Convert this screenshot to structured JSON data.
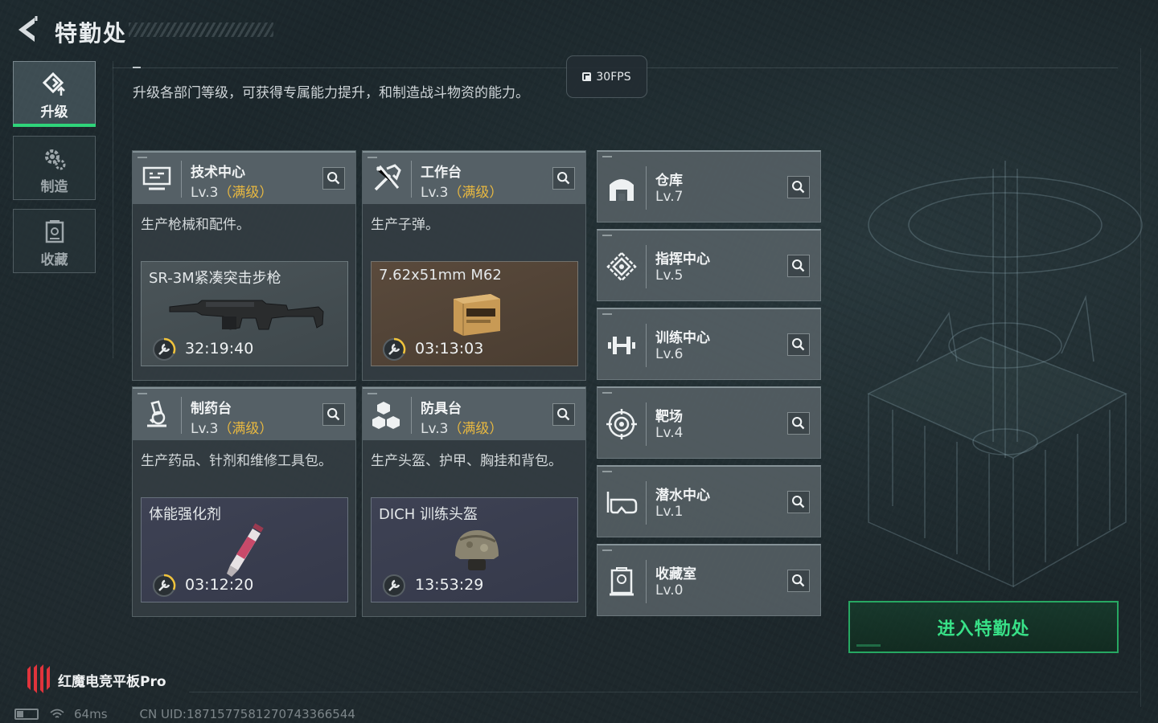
{
  "header": {
    "title": "特勤处",
    "description": "升级各部门等级，可获得专属能力提升，和制造战斗物资的能力。",
    "fps": "30FPS"
  },
  "nav": [
    {
      "label": "升级",
      "icon": "upgrade-icon",
      "active": true
    },
    {
      "label": "制造",
      "icon": "gears-icon",
      "active": false
    },
    {
      "label": "收藏",
      "icon": "collection-icon",
      "active": false
    }
  ],
  "cards": [
    {
      "name": "技术中心",
      "level": "Lv.3",
      "max": "（满级）",
      "desc": "生产枪械和配件。",
      "product": "SR-3M紧凑突击步枪",
      "timer": "32:19:40",
      "icon": "computer-icon"
    },
    {
      "name": "工作台",
      "level": "Lv.3",
      "max": "（满级）",
      "desc": "生产子弹。",
      "product": "7.62x51mm M62",
      "timer": "03:13:03",
      "icon": "tools-icon"
    },
    {
      "name": "制药台",
      "level": "Lv.3",
      "max": "（满级）",
      "desc": "生产药品、针剂和维修工具包。",
      "product": "体能强化剂",
      "timer": "03:12:20",
      "icon": "microscope-icon"
    },
    {
      "name": "防具台",
      "level": "Lv.3",
      "max": "（满级）",
      "desc": "生产头盔、护甲、胸挂和背包。",
      "product": "DICH 训练头盔",
      "timer": "13:53:29",
      "icon": "armor-blocks-icon"
    }
  ],
  "small_cards": [
    {
      "name": "仓库",
      "level": "Lv.7",
      "icon": "warehouse-icon"
    },
    {
      "name": "指挥中心",
      "level": "Lv.5",
      "icon": "command-center-icon"
    },
    {
      "name": "训练中心",
      "level": "Lv.6",
      "icon": "dumbbell-icon"
    },
    {
      "name": "靶场",
      "level": "Lv.4",
      "icon": "target-icon"
    },
    {
      "name": "潜水中心",
      "level": "Lv.1",
      "icon": "diving-mask-icon"
    },
    {
      "name": "收藏室",
      "level": "Lv.0",
      "icon": "collection-room-icon"
    }
  ],
  "enter_button": "进入特勤处",
  "brand": "红魔电竞平板Pro",
  "status": {
    "ping": "64ms",
    "uid": "CN UID:1871577581270743366544"
  },
  "colors": {
    "accent_green": "#2fd47a",
    "max_level_gold": "#e8b840"
  }
}
